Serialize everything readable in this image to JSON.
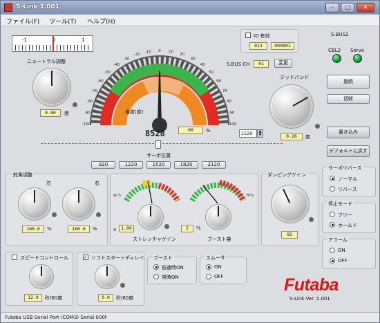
{
  "window": {
    "title": "S-Link 1.001"
  },
  "menu": [
    "ファイル(F)",
    "ツール(T)",
    "ヘルプ(H)"
  ],
  "top_ruler": {
    "labels": [
      "-1",
      "0",
      "1"
    ]
  },
  "neutral": {
    "label": "ニュートラル調整",
    "value": "0.00",
    "unit": "度"
  },
  "id_enable": {
    "label": "ID 有効",
    "value_a": "013",
    "value_b": "000001"
  },
  "sbus_ch": {
    "label": "S.BUS CH",
    "value": "01",
    "button": "変更"
  },
  "gauge": {
    "scale": [
      "-100",
      "-90",
      "-80",
      "-70",
      "-60",
      "-50",
      "-40",
      "-30",
      "-20",
      "-10",
      "0",
      "10",
      "20",
      "30",
      "40",
      "50",
      "60",
      "70",
      "80",
      "90",
      "100"
    ],
    "center_label": "角度(度)",
    "digital": "8528",
    "percent": "00",
    "percent_unit": "%",
    "spin_value": "1520"
  },
  "right_top": {
    "sbus2": "S.BUS2",
    "cbl2": "CBL2",
    "servo": "Servo",
    "connect": "接続",
    "disconnect": "切断",
    "write": "書き込み",
    "default": "デフォルトに戻す"
  },
  "deadband": {
    "label": "デッドバンド",
    "value": "0.26",
    "unit": "度"
  },
  "servo_pos": {
    "label": "サーボ位置",
    "presets": [
      "920",
      "1220",
      "1520",
      "1820",
      "2120"
    ]
  },
  "rudder": {
    "label": "舵角調整",
    "left_label": "左",
    "right_label": "右",
    "left_value": "100.0",
    "right_value": "100.0",
    "unit": "%"
  },
  "stretcher": {
    "label": "ストレッチャゲイン",
    "value": "1.00",
    "prefix": "x",
    "meter_left": [
      "x0.5",
      "x1.0",
      "x1.5",
      "x2.0",
      "x2.5",
      "x3.0"
    ]
  },
  "boost": {
    "label": "ブースト量",
    "value": "5",
    "unit": "%",
    "meter": [
      "1%",
      "12%",
      "20%",
      "28%",
      "36%",
      "44%",
      "50%",
      "60%",
      "70%"
    ]
  },
  "damping": {
    "label": "ダンピングゲイン",
    "value": "95"
  },
  "servo_reverse": {
    "label": "サーボリバース",
    "options": [
      "ノーマル",
      "リバース"
    ],
    "selected": 0
  },
  "stop_mode": {
    "label": "停止モード",
    "options": [
      "フリー",
      "ホールド"
    ],
    "selected": 1
  },
  "alarm": {
    "label": "アラーム",
    "options": [
      "ON",
      "OFF"
    ],
    "selected": 1
  },
  "speed_control": {
    "label": "スピードコントロール",
    "checked": false,
    "value": "12.0",
    "unit": "秒/60度"
  },
  "soft_start": {
    "label": "ソフトスタートディレイ",
    "checked": true,
    "value": "0.0",
    "unit": "秒/60度"
  },
  "boost_mode": {
    "label": "ブースト",
    "options": [
      "低速時ON",
      "常時ON"
    ],
    "selected": 0
  },
  "smoother": {
    "label": "スムーサ",
    "options": [
      "ON",
      "OFF"
    ],
    "selected": 0
  },
  "brand": {
    "logo": "Futaba",
    "version": "S-Link  Ver. 1.001"
  },
  "status_bar": {
    "text": "Futaba USB Serial Port (COM3)  Serial 000f"
  },
  "colors": {
    "red": "#e02a22",
    "orange": "#ef8a22",
    "green": "#3bb54a",
    "yellow": "#f6f2b0"
  }
}
